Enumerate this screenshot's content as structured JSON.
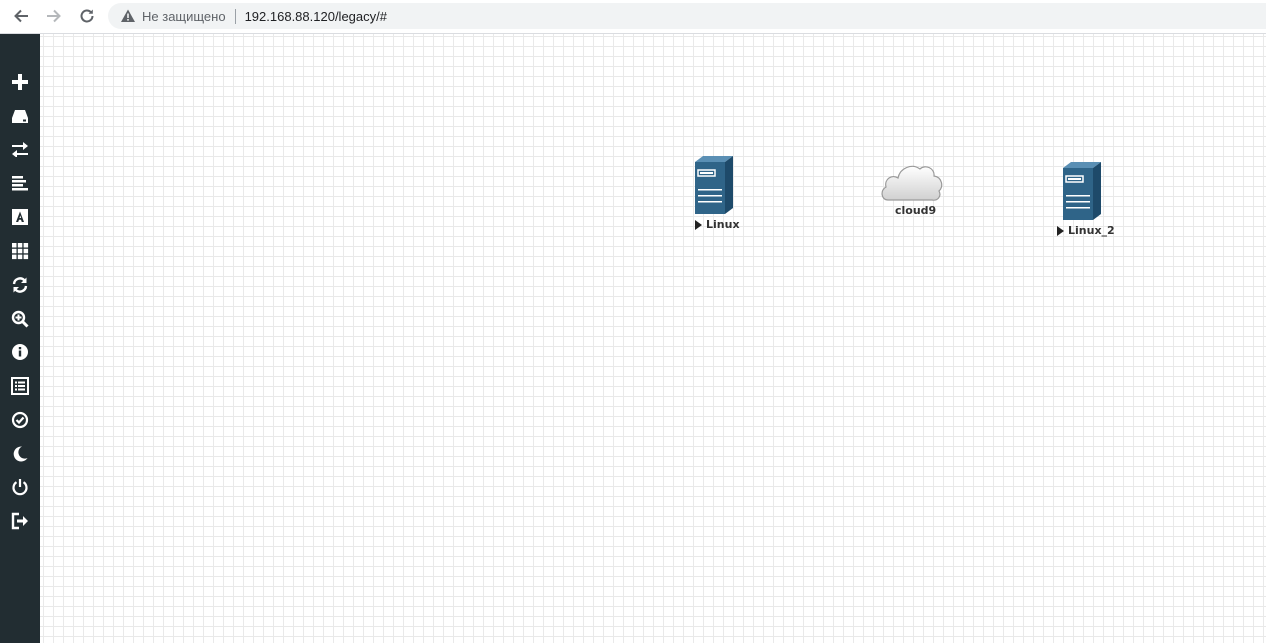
{
  "browser": {
    "security_label": "Не защищено",
    "url": "192.168.88.120/legacy/#"
  },
  "sidebar": {
    "items": [
      {
        "name": "add-object",
        "icon": "plus-icon"
      },
      {
        "name": "nodes",
        "icon": "hdd-icon"
      },
      {
        "name": "networks",
        "icon": "exchange-icon"
      },
      {
        "name": "startup-configs",
        "icon": "align-left-icon"
      },
      {
        "name": "text",
        "icon": "font-icon"
      },
      {
        "name": "pictures",
        "icon": "grid-icon"
      },
      {
        "name": "refresh",
        "icon": "refresh-icon"
      },
      {
        "name": "zoom",
        "icon": "zoom-icon"
      },
      {
        "name": "status",
        "icon": "info-icon"
      },
      {
        "name": "lab-details",
        "icon": "list-icon"
      },
      {
        "name": "lock",
        "icon": "check-circle-icon"
      },
      {
        "name": "dark-mode",
        "icon": "moon-icon"
      },
      {
        "name": "close-lab",
        "icon": "power-icon"
      },
      {
        "name": "logout",
        "icon": "sign-out-icon"
      }
    ]
  },
  "canvas": {
    "nodes": [
      {
        "label": "Linux",
        "type": "server",
        "status": "stopped"
      },
      {
        "label": "cloud9",
        "type": "cloud"
      },
      {
        "label": "Linux_2",
        "type": "server",
        "status": "stopped"
      }
    ]
  },
  "colors": {
    "sidebar_bg": "#222d32",
    "server_blue": "#2f6488",
    "grid_line": "#e9e9e9"
  }
}
